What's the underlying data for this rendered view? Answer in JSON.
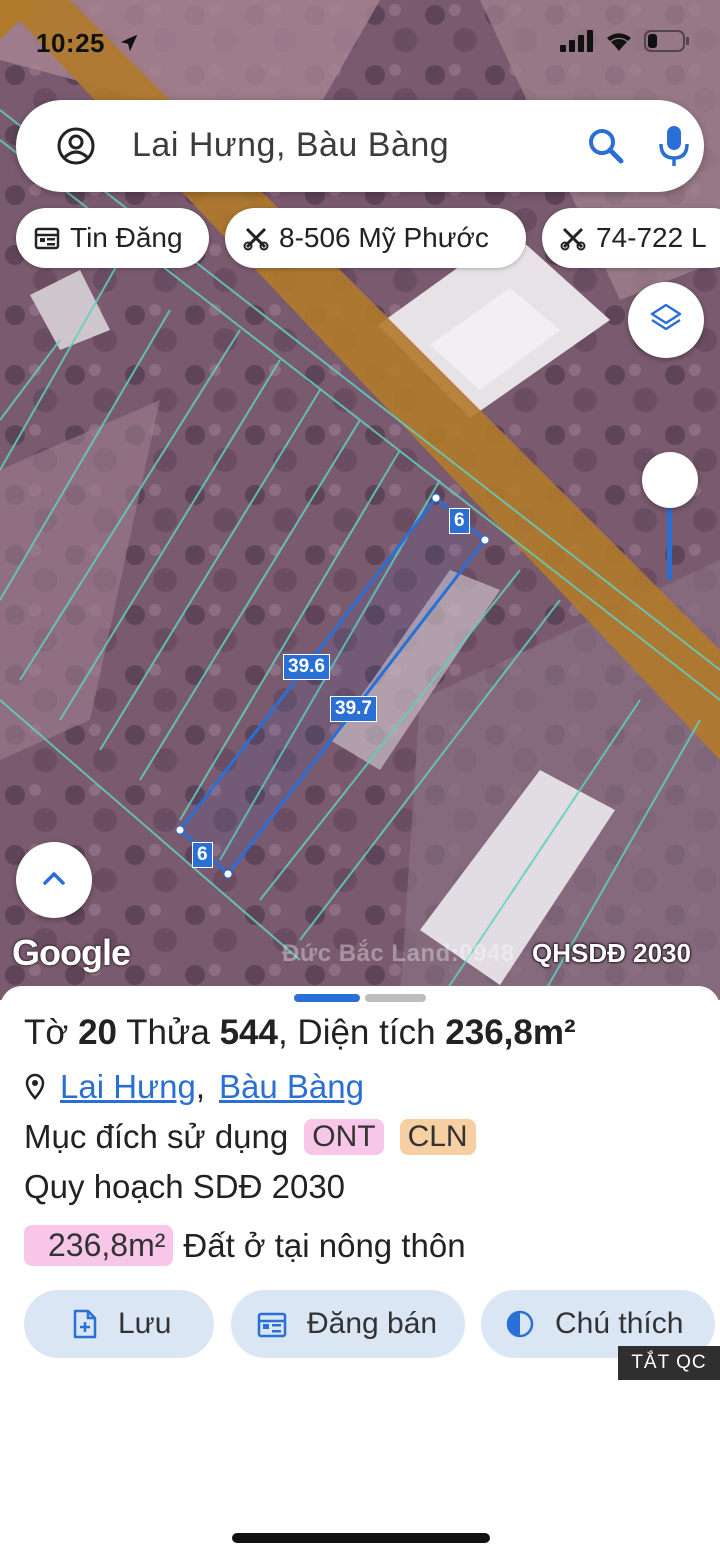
{
  "status": {
    "time": "10:25"
  },
  "search": {
    "query": "Lai Hưng, Bàu Bàng"
  },
  "chips": [
    {
      "label": "Tin Đăng",
      "icon": "calendar-icon"
    },
    {
      "label": "8-506 Mỹ Phước",
      "icon": "scissors-icon"
    },
    {
      "label": "74-722 L",
      "icon": "scissors-icon"
    }
  ],
  "map": {
    "google_logo": "Google",
    "watermark": "Đức Bắc Land:0948",
    "overlay_label": "QHSDĐ 2030",
    "dimensions": {
      "top": "6",
      "left": "39.6",
      "right": "39.7",
      "bottom": "6"
    }
  },
  "parcel": {
    "title_prefix": "Tờ ",
    "sheet_no": "20",
    "title_mid1": " Thửa ",
    "plot_no": "544",
    "title_mid2": ", Diện tích ",
    "area": "236,8m²",
    "address_part1": "Lai Hưng",
    "address_sep": ",",
    "address_part2": "Bàu Bàng",
    "purpose_label": "Mục đích sử dụng",
    "purpose_badges": [
      {
        "code": "ONT",
        "color": "#f7c6e8"
      },
      {
        "code": "CLN",
        "color": "#f6cfa2"
      }
    ],
    "plan_label": "Quy hoạch SDĐ 2030",
    "plan_area": "236,8m²",
    "plan_desc": "Đất ở tại nông thôn"
  },
  "actions": {
    "save": "Lưu",
    "post": "Đăng bán",
    "legend": "Chú thích"
  },
  "ad_toggle": "TẮT QC",
  "colors": {
    "accent": "#2a6fd6",
    "button_bg": "#dbe6f5",
    "road": "#b07a2a"
  }
}
